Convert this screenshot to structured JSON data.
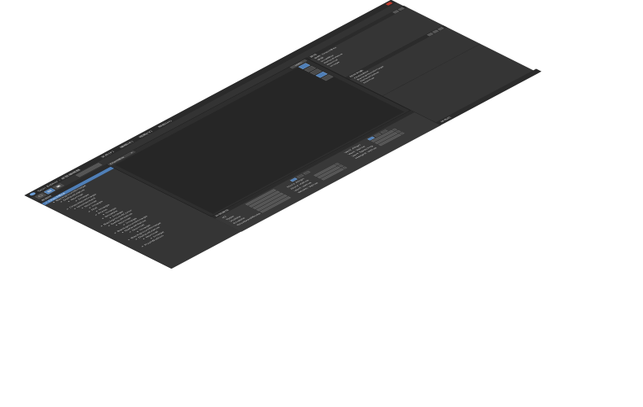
{
  "window": {
    "title": "Skin Editor - 皮肤编辑器"
  },
  "menu": {
    "items": [
      "文件(F)",
      "编辑(E)",
      "视图(V)",
      "帮助(H)"
    ]
  },
  "toolbar": {
    "buttons": [
      {
        "icon": "new-file-icon",
        "glyph": "▢"
      },
      {
        "icon": "open-icon",
        "glyph": "▤"
      },
      {
        "icon": "save-icon",
        "glyph": "▣"
      }
    ]
  },
  "left_panel": {
    "title": "资源树",
    "tree": [
      {
        "label": "CheckBox",
        "level": 0,
        "selected": true
      },
      {
        "label": "BackgroundImage",
        "level": 1
      },
      {
        "label": "DefaultValue",
        "level": 2
      },
      {
        "label": "Normal",
        "level": 3
      },
      {
        "label": "Image",
        "level": 4
      },
      {
        "label": "CheckboxImage",
        "level": 1
      },
      {
        "label": "Unchecked",
        "level": 2
      },
      {
        "label": "Normal",
        "level": 3
      },
      {
        "label": "Image",
        "level": 4
      },
      {
        "label": "Hot",
        "level": 3
      },
      {
        "label": "Image",
        "level": 4
      },
      {
        "label": "Press",
        "level": 3
      },
      {
        "label": "Image",
        "level": 4
      },
      {
        "label": "Disable",
        "level": 3
      },
      {
        "label": "Image",
        "level": 4
      },
      {
        "label": "BackgroundColor",
        "level": 1
      },
      {
        "label": "DefaultValue",
        "level": 2
      },
      {
        "label": "Normal",
        "level": 3
      },
      {
        "label": "Image",
        "level": 4
      },
      {
        "label": "BackgroundImage",
        "level": 1
      },
      {
        "label": "DefaultValue",
        "level": 2
      },
      {
        "label": "Normal",
        "level": 3
      },
      {
        "label": "Image",
        "level": 4
      },
      {
        "label": "BackgroundImage",
        "level": 1
      },
      {
        "label": "DefaultValue",
        "level": 2
      },
      {
        "label": "Normal",
        "level": 3
      },
      {
        "label": "Image",
        "level": 4
      },
      {
        "label": "PushButton",
        "level": 1
      }
    ]
  },
  "canvas": {
    "tab_label": "CheckBox",
    "zoom": "100%"
  },
  "right_panel": {
    "properties": {
      "title": "属性",
      "rows": [
        "名称: CheckBox",
        "类型",
        "ScrollBar",
        "DefaultValue",
        "Normal",
        "Image"
      ]
    },
    "tree": {
      "title": "控件列表",
      "rows": [
        "CheckBox",
        "BackgroundImage",
        "DefaultValue",
        "Normal"
      ]
    },
    "status": "状态栏"
  },
  "bottom_panel": {
    "title": "外观属性",
    "fields": [
      "ID",
      "Type",
      "Visible",
      "Enable",
      "DisabledMode"
    ],
    "group_mid": [
      "Horz Align",
      "Horz Value",
      "Vert Value",
      "Width Value"
    ],
    "group_right": [
      "Vert Align",
      "Vert Value",
      "Vert Spacing",
      "Height Value"
    ]
  },
  "colors": {
    "bg": "#3a3a3a",
    "panel": "#353535",
    "accent": "#4f7fb8"
  }
}
